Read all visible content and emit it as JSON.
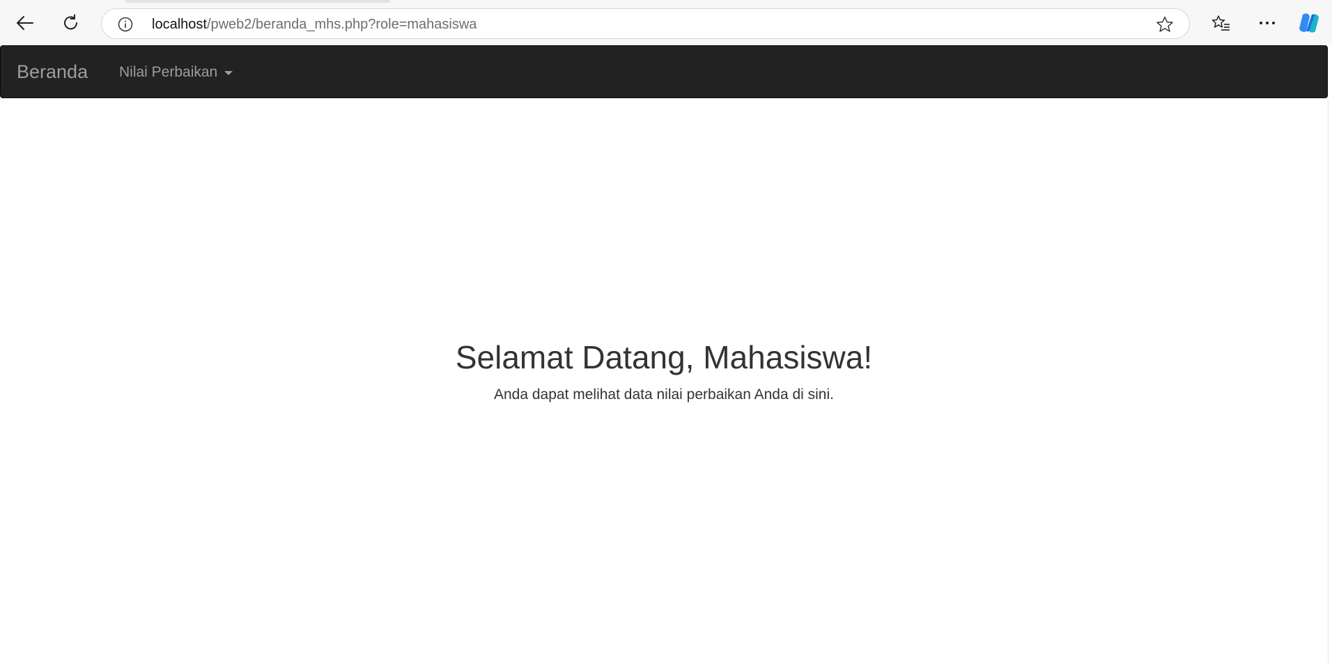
{
  "browser": {
    "url_host": "localhost",
    "url_path": "/pweb2/beranda_mhs.php?role=mahasiswa",
    "icons": [
      "back-icon",
      "reload-icon",
      "site-info-icon",
      "favorite-star-icon",
      "favorites-list-icon",
      "more-icon",
      "copilot-icon"
    ]
  },
  "navbar": {
    "brand": "Beranda",
    "dropdown_label": "Nilai Perbaikan",
    "background": "#222222",
    "text_color": "#9d9d9d"
  },
  "main": {
    "heading": "Selamat Datang, Mahasiswa!",
    "subtext": "Anda dapat melihat data nilai perbaikan Anda di sini."
  }
}
